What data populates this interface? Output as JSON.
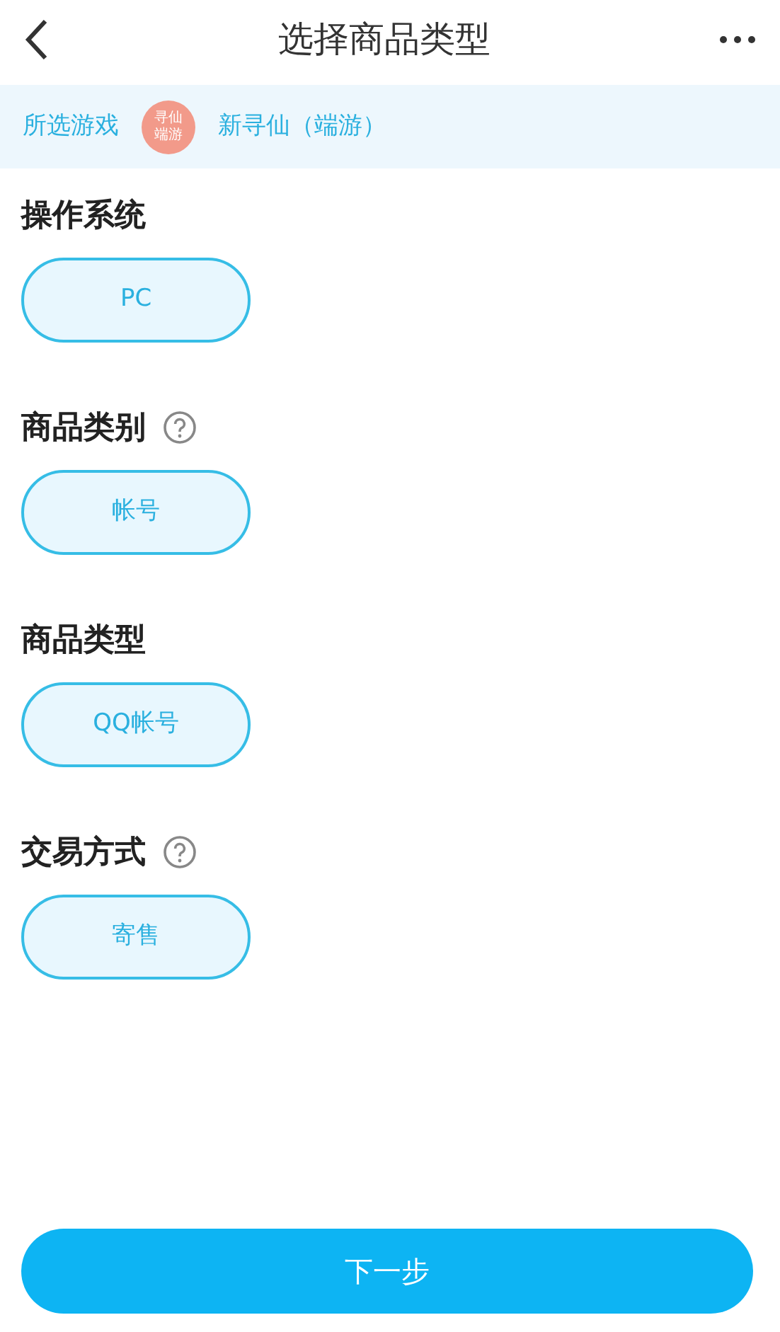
{
  "header": {
    "title": "选择商品类型"
  },
  "game": {
    "label": "所选游戏",
    "icon_text": [
      "寻仙",
      "端游"
    ],
    "name": "新寻仙（端游）"
  },
  "sections": [
    {
      "title": "操作系统",
      "help": false,
      "options": [
        {
          "label": "PC",
          "selected": true
        }
      ]
    },
    {
      "title": "商品类别",
      "help": true,
      "options": [
        {
          "label": "帐号",
          "selected": true
        }
      ]
    },
    {
      "title": "商品类型",
      "help": false,
      "options": [
        {
          "label": "QQ帐号",
          "selected": true
        }
      ]
    },
    {
      "title": "交易方式",
      "help": true,
      "options": [
        {
          "label": "寄售",
          "selected": true
        }
      ]
    }
  ],
  "next_button": "下一步"
}
